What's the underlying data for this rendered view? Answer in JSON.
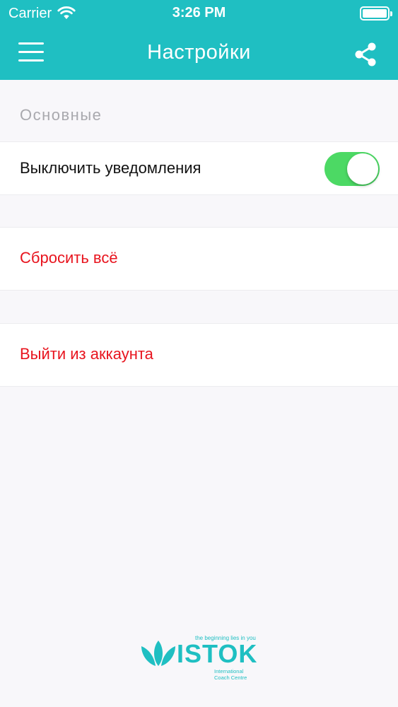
{
  "status_bar": {
    "carrier": "Carrier",
    "time": "3:26 PM"
  },
  "nav": {
    "title": "Настройки",
    "menu_icon": "hamburger-menu-icon",
    "share_icon": "share-icon"
  },
  "section": {
    "header": "Основные"
  },
  "settings": {
    "notifications_label": "Выключить уведомления",
    "notifications_toggle_on": true,
    "reset_label": "Сбросить всё",
    "logout_label": "Выйти из аккаунта"
  },
  "logo": {
    "tagline": "the beginning lies in you",
    "wordmark": "ISTOK",
    "sub_line1": "International",
    "sub_line2": "Coach Centre"
  },
  "colors": {
    "accent": "#1fbfc2",
    "toggle_on": "#4cd964",
    "destructive": "#e8141e",
    "section_header": "#a9a9ae"
  }
}
